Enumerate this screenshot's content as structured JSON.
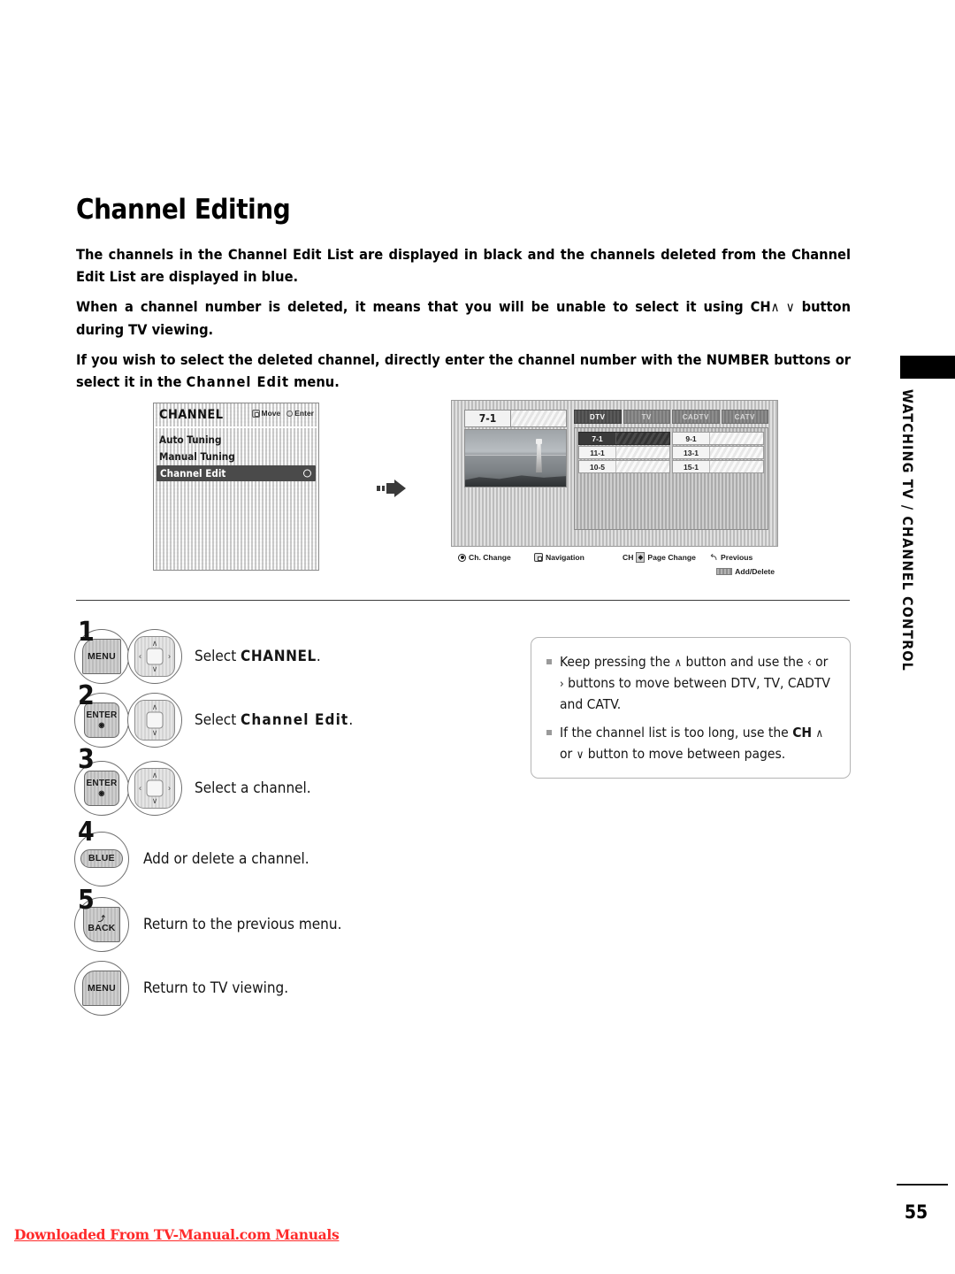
{
  "page": {
    "title": "Channel Editing",
    "number": "55",
    "side_tab": "WATCHING TV / CHANNEL CONTROL",
    "footer_link": "Downloaded From TV-Manual.com Manuals"
  },
  "intro": {
    "p1": "The channels in the Channel Edit List are displayed in black and the channels deleted from the Channel Edit List are displayed in blue.",
    "p2_a": "When a channel number is deleted, it means that you will be unable to select it using ",
    "p2_ch": "CH",
    "p2_arrows": "∧ ∨",
    "p2_b": " button during TV viewing.",
    "p3_a": "If you wish to select the deleted channel, directly enter the channel number with the NUMBER buttons or select it in the ",
    "p3_menu": "Channel Edit",
    "p3_b": " menu."
  },
  "osd_menu": {
    "title": "CHANNEL",
    "hint_move": "Move",
    "hint_enter": "Enter",
    "items": [
      {
        "label": "Auto Tuning",
        "selected": false
      },
      {
        "label": "Manual Tuning",
        "selected": false
      },
      {
        "label": "Channel Edit",
        "selected": true
      }
    ]
  },
  "osd_tv": {
    "preview_channel": "7-1",
    "tabs": [
      {
        "label": "DTV",
        "active": true
      },
      {
        "label": "TV",
        "active": false
      },
      {
        "label": "CADTV",
        "active": false
      },
      {
        "label": "CATV",
        "active": false
      }
    ],
    "channels": [
      {
        "num": "7-1",
        "selected": true
      },
      {
        "num": "9-1",
        "selected": false
      },
      {
        "num": "11-1",
        "selected": false
      },
      {
        "num": "13-1",
        "selected": false
      },
      {
        "num": "10-5",
        "selected": false
      },
      {
        "num": "15-1",
        "selected": false
      }
    ],
    "legend": [
      {
        "label": "Ch. Change",
        "icon": "target-icon"
      },
      {
        "label": "Navigation",
        "icon": "navpad-icon"
      },
      {
        "label": "Page Change",
        "prefix": "CH",
        "icon": "updown-icon"
      },
      {
        "label": "Previous",
        "icon": "return-arrow-icon"
      },
      {
        "label": "Add/Delete",
        "icon": "blue-bar-icon"
      }
    ]
  },
  "steps": [
    {
      "num": "1",
      "key": "MENU",
      "text_a": "Select ",
      "text_b": "CHANNEL",
      "text_c": ".",
      "bold_style": "caps"
    },
    {
      "num": "2",
      "key": "ENTER",
      "text_a": "Select ",
      "text_b": "Channel Edit",
      "text_c": ".",
      "bold_style": "spaced"
    },
    {
      "num": "3",
      "key": "ENTER",
      "text_a": "Select a channel.",
      "text_b": "",
      "text_c": "",
      "bold_style": "none"
    },
    {
      "num": "4",
      "key": "BLUE",
      "text_a": "Add or delete a channel.",
      "text_b": "",
      "text_c": "",
      "bold_style": "none"
    },
    {
      "num": "5",
      "key": "BACK",
      "text_a": "Return to the previous menu.",
      "text_b": "",
      "text_c": "",
      "bold_style": "none"
    },
    {
      "num": "",
      "key": "MENU",
      "text_a": "Return to TV viewing.",
      "text_b": "",
      "text_c": "",
      "bold_style": "none"
    }
  ],
  "note": {
    "bullet1_a": "Keep pressing the ",
    "bullet1_up": "∧",
    "bullet1_b": " button and use the ",
    "bullet1_lt": "‹",
    "bullet1_or": " or ",
    "bullet1_gt": "›",
    "bullet1_c": " buttons to move between DTV, TV, CADTV and CATV.",
    "bullet2_a": "If the channel list is too long, use the ",
    "bullet2_ch": "CH",
    "bullet2_up": "∧",
    "bullet2_or": " or ",
    "bullet2_dn": "∨",
    "bullet2_b": " button to move between pages."
  },
  "keys": {
    "menu": "MENU",
    "enter": "ENTER",
    "enter_sub": "◉",
    "blue": "BLUE",
    "back": "BACK",
    "back_arc": "⤴"
  },
  "colors": {
    "link_red": "#ff2a2a",
    "selected_bg": "#4a4a4a",
    "rule": "#3d3d3d"
  }
}
